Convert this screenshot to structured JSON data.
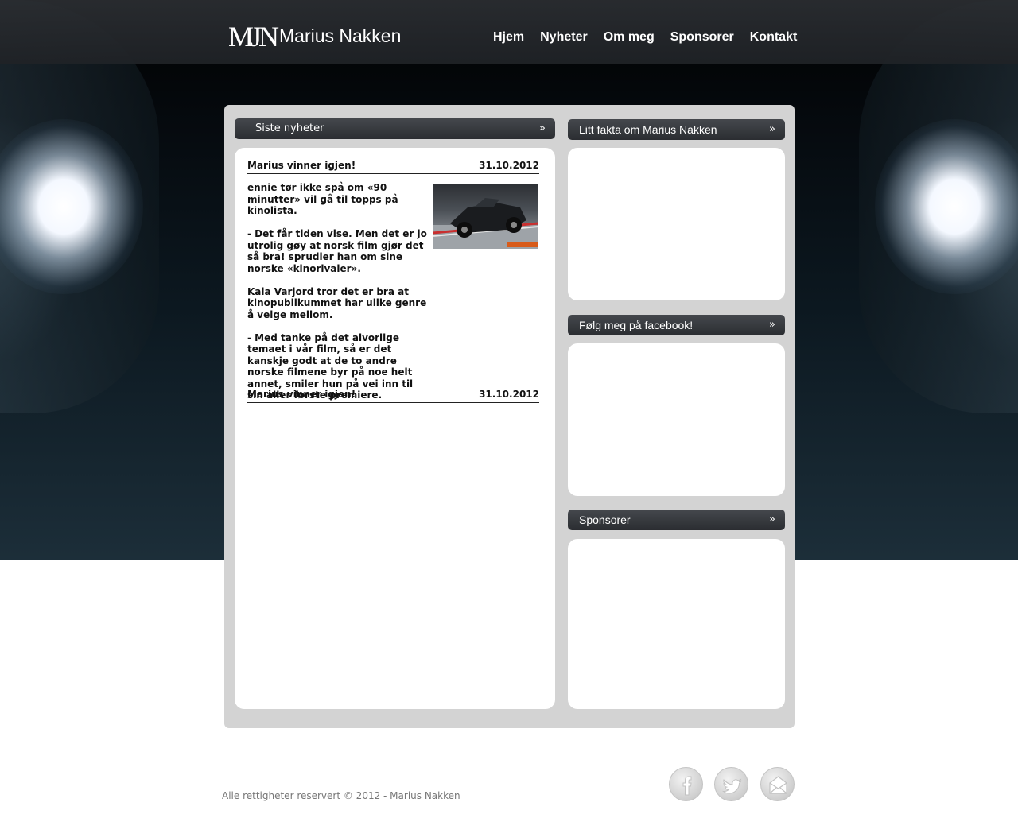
{
  "header": {
    "logo_text": "MJN",
    "site_title": "Marius Nakken",
    "nav": [
      "Hjem",
      "Nyheter",
      "Om meg",
      "Sponsorer",
      "Kontakt"
    ]
  },
  "news": {
    "section_title": "Siste nyheter",
    "arrow": "»",
    "articles": [
      {
        "title": "Marius vinner igjen!",
        "date": "31.10.2012",
        "paragraphs": [
          "ennie tør ikke spå om «90 minutter» vil gå til topps på kinolista.",
          "- Det får tiden vise. Men det er jo utrolig gøy at norsk film gjør det så bra! sprudler han om sine norske «kinorivaler».",
          "Kaia Varjord tror det er bra at kinopublikummet har ulike genre å velge mellom.",
          "- Med tanke på det alvorlige temaet i vår film, så er det kanskje godt at de to andre norske filmene byr på noe helt annet, smiler hun på vei inn til sin aller første premiere."
        ]
      },
      {
        "title": "Marius vinner igjen!",
        "date": "31.10.2012"
      }
    ]
  },
  "sidebar": {
    "sections": [
      {
        "title": "Litt fakta om Marius Nakken",
        "arrow": "»"
      },
      {
        "title": "Følg meg på facebook!",
        "arrow": "»"
      },
      {
        "title": "Sponsorer",
        "arrow": "»"
      }
    ]
  },
  "footer": {
    "copyright": "Alle rettigheter reservert © 2012 - Marius Nakken",
    "social": [
      "facebook-icon",
      "twitter-icon",
      "email-icon"
    ]
  }
}
